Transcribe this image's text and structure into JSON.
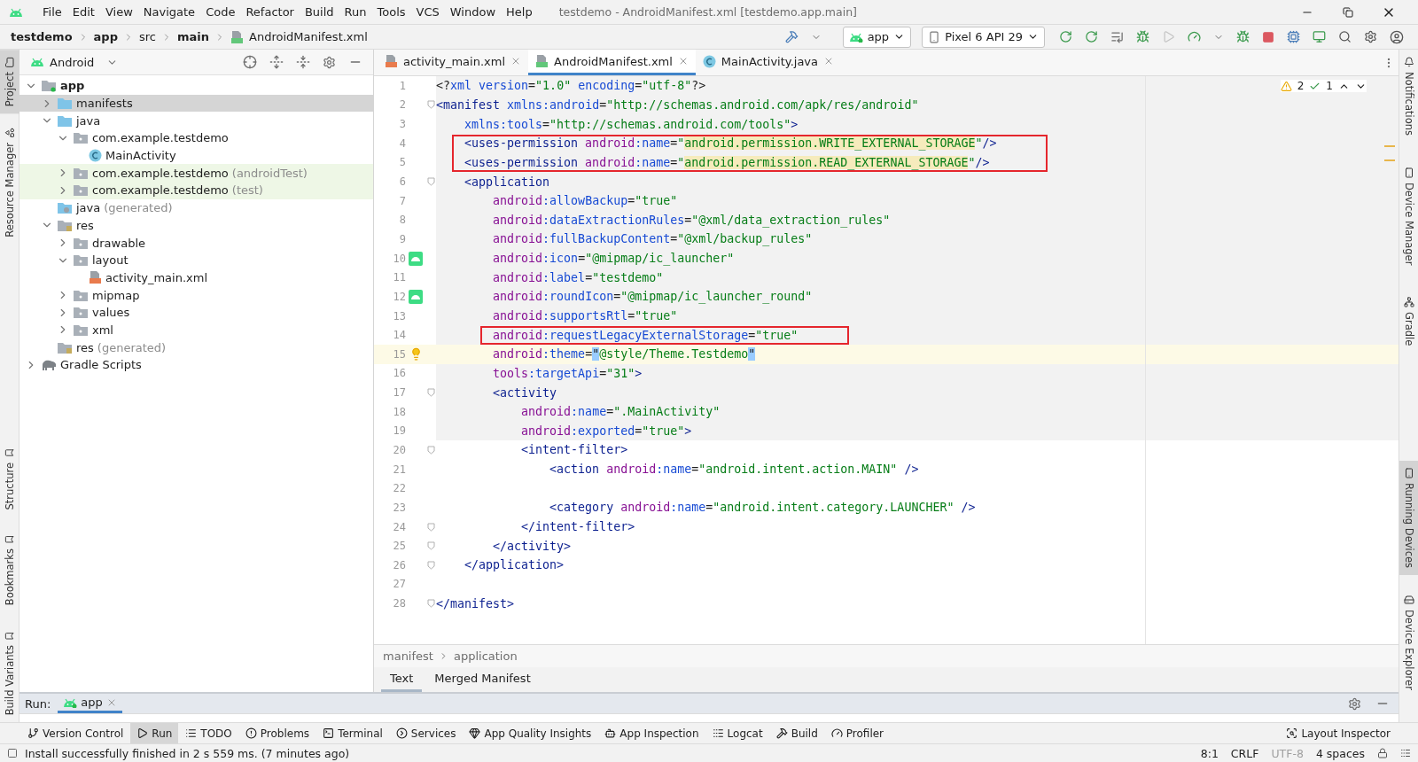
{
  "window": {
    "title": "testdemo - AndroidManifest.xml [testdemo.app.main]",
    "menu": [
      "File",
      "Edit",
      "View",
      "Navigate",
      "Code",
      "Refactor",
      "Build",
      "Run",
      "Tools",
      "VCS",
      "Window",
      "Help"
    ]
  },
  "navbar": {
    "breadcrumbs": [
      {
        "text": "testdemo",
        "bold": true
      },
      {
        "text": "app",
        "bold": true
      },
      {
        "text": "src",
        "bold": false
      },
      {
        "text": "main",
        "bold": true
      },
      {
        "text": "AndroidManifest.xml",
        "bold": false
      }
    ],
    "run_config": "app",
    "device": "Pixel 6 API 29"
  },
  "left_strip": {
    "top": [
      {
        "label": "Project",
        "selected": true
      },
      {
        "label": "Resource Manager",
        "selected": false
      }
    ],
    "bottom": [
      {
        "label": "Structure",
        "selected": false
      },
      {
        "label": "Bookmarks",
        "selected": false
      },
      {
        "label": "Build Variants",
        "selected": false
      }
    ]
  },
  "right_strip": {
    "top": [
      {
        "label": "Notifications",
        "selected": false
      },
      {
        "label": "Device Manager",
        "selected": false
      },
      {
        "label": "Gradle",
        "selected": false
      }
    ],
    "bottom": [
      {
        "label": "Running Devices",
        "selected": true
      },
      {
        "label": "Device Explorer",
        "selected": false
      }
    ]
  },
  "project": {
    "view": "Android",
    "tree": [
      {
        "label": "app",
        "kind": "module",
        "expandable": true,
        "expanded": true,
        "selected": false,
        "tinted": false,
        "children": [
          {
            "label": "manifests",
            "kind": "folder",
            "expandable": true,
            "expanded": false,
            "selected": true,
            "tinted": false
          },
          {
            "label": "java",
            "kind": "folder",
            "expandable": true,
            "expanded": true,
            "selected": false,
            "tinted": false,
            "children": [
              {
                "label": "com.example.testdemo",
                "kind": "package",
                "expandable": true,
                "expanded": true,
                "selected": false,
                "tinted": false,
                "children": [
                  {
                    "label": "MainActivity",
                    "kind": "class",
                    "expandable": false,
                    "selected": false,
                    "tinted": false
                  }
                ]
              },
              {
                "label": "com.example.testdemo",
                "note": "(androidTest)",
                "kind": "package",
                "expandable": true,
                "expanded": false,
                "selected": false,
                "tinted": true
              },
              {
                "label": "com.example.testdemo",
                "note": "(test)",
                "kind": "package",
                "expandable": true,
                "expanded": false,
                "selected": false,
                "tinted": true
              }
            ]
          },
          {
            "label": "java",
            "note": "(generated)",
            "kind": "generated",
            "expandable": false,
            "selected": false,
            "tinted": false
          },
          {
            "label": "res",
            "kind": "res",
            "expandable": true,
            "expanded": true,
            "selected": false,
            "tinted": false,
            "children": [
              {
                "label": "drawable",
                "kind": "package",
                "expandable": true,
                "expanded": false,
                "selected": false,
                "tinted": false
              },
              {
                "label": "layout",
                "kind": "package",
                "expandable": true,
                "expanded": true,
                "selected": false,
                "tinted": false,
                "children": [
                  {
                    "label": "activity_main.xml",
                    "kind": "layout",
                    "expandable": false,
                    "selected": false,
                    "tinted": false
                  }
                ]
              },
              {
                "label": "mipmap",
                "kind": "package",
                "expandable": true,
                "expanded": false,
                "selected": false,
                "tinted": false
              },
              {
                "label": "values",
                "kind": "package",
                "expandable": true,
                "expanded": false,
                "selected": false,
                "tinted": false
              },
              {
                "label": "xml",
                "kind": "package",
                "expandable": true,
                "expanded": false,
                "selected": false,
                "tinted": false
              }
            ]
          },
          {
            "label": "res",
            "note": "(generated)",
            "kind": "res",
            "expandable": false,
            "selected": false,
            "tinted": false
          }
        ]
      },
      {
        "label": "Gradle Scripts",
        "kind": "gradle",
        "expandable": true,
        "expanded": false,
        "selected": false,
        "tinted": false
      }
    ]
  },
  "editor": {
    "tabs": [
      {
        "label": "activity_main.xml",
        "kind": "layout",
        "selected": false
      },
      {
        "label": "AndroidManifest.xml",
        "kind": "manifest",
        "selected": true
      },
      {
        "label": "MainActivity.java",
        "kind": "class",
        "selected": false
      }
    ],
    "inspections": {
      "warnings": "2",
      "passed": "1"
    },
    "lines": [
      {
        "number": "1",
        "kind": "plain",
        "shaded": true,
        "caret": false,
        "fold": false,
        "boxed": false,
        "tokens": [
          {
            "kind": "p",
            "text": "<?"
          },
          {
            "kind": "a",
            "text": "xml"
          },
          {
            "kind": "a",
            "text": " version"
          },
          {
            "kind": "p",
            "text": "="
          },
          {
            "kind": "v",
            "text": "\"1.0\""
          },
          {
            "kind": "a",
            "text": " encoding"
          },
          {
            "kind": "p",
            "text": "="
          },
          {
            "kind": "v",
            "text": "\"utf-8\""
          },
          {
            "kind": "p",
            "text": "?>"
          }
        ]
      },
      {
        "number": "2",
        "kind": "plain",
        "shaded": true,
        "caret": false,
        "fold": true,
        "boxed": false,
        "tokens": [
          {
            "kind": "t",
            "text": "<manifest"
          },
          {
            "kind": "a",
            "text": " xmlns:android"
          },
          {
            "kind": "p",
            "text": "="
          },
          {
            "kind": "v",
            "text": "\"http://schemas.android.com/apk/res/android\""
          }
        ]
      },
      {
        "number": "3",
        "kind": "plain",
        "shaded": true,
        "caret": false,
        "fold": false,
        "boxed": false,
        "tokens": [
          {
            "kind": "a",
            "text": "    xmlns:tools"
          },
          {
            "kind": "p",
            "text": "="
          },
          {
            "kind": "v",
            "text": "\"http://schemas.android.com/tools\""
          },
          {
            "kind": "t",
            "text": ">"
          }
        ]
      },
      {
        "number": "4",
        "kind": "plain",
        "shaded": true,
        "caret": false,
        "fold": false,
        "boxed": true,
        "tokens": [
          {
            "kind": "t",
            "text": "    <uses-permission"
          },
          {
            "kind": "n",
            "text": " android"
          },
          {
            "kind": "a",
            "text": ":name"
          },
          {
            "kind": "p",
            "text": "="
          },
          {
            "kind": "v",
            "text": "\""
          },
          {
            "kind": "h",
            "text": "android.permission.WRITE_EXTERNAL_STORAGE"
          },
          {
            "kind": "v",
            "text": "\""
          },
          {
            "kind": "t",
            "text": "/>"
          }
        ]
      },
      {
        "number": "5",
        "kind": "plain",
        "shaded": true,
        "caret": false,
        "fold": false,
        "boxed": true,
        "tokens": [
          {
            "kind": "t",
            "text": "    <uses-permission"
          },
          {
            "kind": "n",
            "text": " android"
          },
          {
            "kind": "a",
            "text": ":name"
          },
          {
            "kind": "p",
            "text": "="
          },
          {
            "kind": "v",
            "text": "\""
          },
          {
            "kind": "h",
            "text": "android.permission.READ_EXTERNAL_STORAGE"
          },
          {
            "kind": "v",
            "text": "\""
          },
          {
            "kind": "t",
            "text": "/>"
          }
        ]
      },
      {
        "number": "6",
        "kind": "plain",
        "shaded": true,
        "caret": false,
        "fold": true,
        "boxed": false,
        "tokens": [
          {
            "kind": "t",
            "text": "    <application"
          }
        ]
      },
      {
        "number": "7",
        "kind": "plain",
        "shaded": true,
        "caret": false,
        "fold": false,
        "boxed": false,
        "tokens": [
          {
            "kind": "n",
            "text": "        android"
          },
          {
            "kind": "a",
            "text": ":allowBackup"
          },
          {
            "kind": "p",
            "text": "="
          },
          {
            "kind": "v",
            "text": "\"true\""
          }
        ]
      },
      {
        "number": "8",
        "kind": "plain",
        "shaded": true,
        "caret": false,
        "fold": false,
        "boxed": false,
        "tokens": [
          {
            "kind": "n",
            "text": "        android"
          },
          {
            "kind": "a",
            "text": ":dataExtractionRules"
          },
          {
            "kind": "p",
            "text": "="
          },
          {
            "kind": "v",
            "text": "\"@xml/data_extraction_rules\""
          }
        ]
      },
      {
        "number": "9",
        "kind": "plain",
        "shaded": true,
        "caret": false,
        "fold": false,
        "boxed": false,
        "tokens": [
          {
            "kind": "n",
            "text": "        android"
          },
          {
            "kind": "a",
            "text": ":fullBackupContent"
          },
          {
            "kind": "p",
            "text": "="
          },
          {
            "kind": "v",
            "text": "\"@xml/backup_rules\""
          }
        ]
      },
      {
        "number": "10",
        "kind": "launcher",
        "shaded": true,
        "caret": false,
        "fold": false,
        "boxed": false,
        "tokens": [
          {
            "kind": "n",
            "text": "        android"
          },
          {
            "kind": "a",
            "text": ":icon"
          },
          {
            "kind": "p",
            "text": "="
          },
          {
            "kind": "v",
            "text": "\"@mipmap/ic_launcher\""
          }
        ]
      },
      {
        "number": "11",
        "kind": "plain",
        "shaded": true,
        "caret": false,
        "fold": false,
        "boxed": false,
        "tokens": [
          {
            "kind": "n",
            "text": "        android"
          },
          {
            "kind": "a",
            "text": ":label"
          },
          {
            "kind": "p",
            "text": "="
          },
          {
            "kind": "v",
            "text": "\"testdemo\""
          }
        ]
      },
      {
        "number": "12",
        "kind": "launcher",
        "shaded": true,
        "caret": false,
        "fold": false,
        "boxed": false,
        "tokens": [
          {
            "kind": "n",
            "text": "        android"
          },
          {
            "kind": "a",
            "text": ":roundIcon"
          },
          {
            "kind": "p",
            "text": "="
          },
          {
            "kind": "v",
            "text": "\"@mipmap/ic_launcher_round\""
          }
        ]
      },
      {
        "number": "13",
        "kind": "plain",
        "shaded": true,
        "caret": false,
        "fold": false,
        "boxed": false,
        "tokens": [
          {
            "kind": "n",
            "text": "        android"
          },
          {
            "kind": "a",
            "text": ":supportsRtl"
          },
          {
            "kind": "p",
            "text": "="
          },
          {
            "kind": "v",
            "text": "\"true\""
          }
        ]
      },
      {
        "number": "14",
        "kind": "plain",
        "shaded": true,
        "caret": false,
        "fold": false,
        "boxed": true,
        "tokens": [
          {
            "kind": "n",
            "text": "        android"
          },
          {
            "kind": "a",
            "text": ":requestLegacyExternalStorage"
          },
          {
            "kind": "p",
            "text": "="
          },
          {
            "kind": "v",
            "text": "\"true\""
          }
        ]
      },
      {
        "number": "15",
        "kind": "bulb",
        "shaded": false,
        "caret": true,
        "fold": false,
        "boxed": false,
        "tokens": [
          {
            "kind": "n",
            "text": "        android"
          },
          {
            "kind": "a",
            "text": ":theme"
          },
          {
            "kind": "p",
            "text": "="
          },
          {
            "kind": "q",
            "text": "\""
          },
          {
            "kind": "v",
            "text": "@style/Theme.Testdemo"
          },
          {
            "kind": "q",
            "text": "\""
          }
        ]
      },
      {
        "number": "16",
        "kind": "plain",
        "shaded": true,
        "caret": false,
        "fold": false,
        "boxed": false,
        "tokens": [
          {
            "kind": "n",
            "text": "        tools"
          },
          {
            "kind": "a",
            "text": ":targetApi"
          },
          {
            "kind": "p",
            "text": "="
          },
          {
            "kind": "v",
            "text": "\"31\""
          },
          {
            "kind": "t",
            "text": ">"
          }
        ]
      },
      {
        "number": "17",
        "kind": "plain",
        "shaded": true,
        "caret": false,
        "fold": true,
        "boxed": false,
        "tokens": [
          {
            "kind": "t",
            "text": "        <activity"
          }
        ]
      },
      {
        "number": "18",
        "kind": "plain",
        "shaded": true,
        "caret": false,
        "fold": false,
        "boxed": false,
        "tokens": [
          {
            "kind": "n",
            "text": "            android"
          },
          {
            "kind": "a",
            "text": ":name"
          },
          {
            "kind": "p",
            "text": "="
          },
          {
            "kind": "v",
            "text": "\".MainActivity\""
          }
        ]
      },
      {
        "number": "19",
        "kind": "plain",
        "shaded": true,
        "caret": false,
        "fold": false,
        "boxed": false,
        "tokens": [
          {
            "kind": "n",
            "text": "            android"
          },
          {
            "kind": "a",
            "text": ":exported"
          },
          {
            "kind": "p",
            "text": "="
          },
          {
            "kind": "v",
            "text": "\"true\""
          },
          {
            "kind": "t",
            "text": ">"
          }
        ]
      },
      {
        "number": "20",
        "kind": "plain",
        "shaded": false,
        "caret": false,
        "fold": true,
        "boxed": false,
        "tokens": [
          {
            "kind": "t",
            "text": "            <intent-filter>"
          }
        ]
      },
      {
        "number": "21",
        "kind": "plain",
        "shaded": false,
        "caret": false,
        "fold": false,
        "boxed": false,
        "tokens": [
          {
            "kind": "t",
            "text": "                <action"
          },
          {
            "kind": "n",
            "text": " android"
          },
          {
            "kind": "a",
            "text": ":name"
          },
          {
            "kind": "p",
            "text": "="
          },
          {
            "kind": "v",
            "text": "\"android.intent.action.MAIN\""
          },
          {
            "kind": "t",
            "text": " />"
          }
        ]
      },
      {
        "number": "22",
        "kind": "plain",
        "shaded": false,
        "caret": false,
        "fold": false,
        "boxed": false
      },
      {
        "number": "23",
        "kind": "plain",
        "shaded": false,
        "caret": false,
        "fold": false,
        "boxed": false,
        "tokens": [
          {
            "kind": "t",
            "text": "                <category"
          },
          {
            "kind": "n",
            "text": " android"
          },
          {
            "kind": "a",
            "text": ":name"
          },
          {
            "kind": "p",
            "text": "="
          },
          {
            "kind": "v",
            "text": "\"android.intent.category.LAUNCHER\""
          },
          {
            "kind": "t",
            "text": " />"
          }
        ]
      },
      {
        "number": "24",
        "kind": "plain",
        "shaded": false,
        "caret": false,
        "fold": true,
        "boxed": false,
        "tokens": [
          {
            "kind": "t",
            "text": "            </intent-filter>"
          }
        ]
      },
      {
        "number": "25",
        "kind": "plain",
        "shaded": false,
        "caret": false,
        "fold": true,
        "boxed": false,
        "tokens": [
          {
            "kind": "t",
            "text": "        </activity>"
          }
        ]
      },
      {
        "number": "26",
        "kind": "plain",
        "shaded": false,
        "caret": false,
        "fold": true,
        "boxed": false,
        "tokens": [
          {
            "kind": "t",
            "text": "    </application>"
          }
        ]
      },
      {
        "number": "27",
        "kind": "plain",
        "shaded": false,
        "caret": false,
        "fold": false,
        "boxed": false
      },
      {
        "number": "28",
        "kind": "plain",
        "shaded": false,
        "caret": false,
        "fold": true,
        "boxed": false,
        "tokens": [
          {
            "kind": "t",
            "text": "</manifest>"
          }
        ]
      }
    ],
    "breadcrumbs": [
      "manifest",
      "application"
    ],
    "view_tabs": [
      {
        "label": "Text",
        "selected": true
      },
      {
        "label": "Merged Manifest",
        "selected": false
      }
    ]
  },
  "run_panel": {
    "title": "Run:",
    "tabs": [
      {
        "label": "app",
        "selected": true
      }
    ]
  },
  "tool_windows": {
    "left": [
      {
        "label": "Version Control",
        "kind": "vcs",
        "selected": false
      },
      {
        "label": "Run",
        "kind": "run",
        "selected": true
      },
      {
        "label": "TODO",
        "kind": "todo",
        "selected": false
      },
      {
        "label": "Problems",
        "kind": "problems",
        "selected": false
      },
      {
        "label": "Terminal",
        "kind": "terminal",
        "selected": false
      },
      {
        "label": "Services",
        "kind": "services",
        "selected": false
      },
      {
        "label": "App Quality Insights",
        "kind": "quality",
        "selected": false
      },
      {
        "label": "App Inspection",
        "kind": "inspection",
        "selected": false
      },
      {
        "label": "Logcat",
        "kind": "logcat",
        "selected": false
      },
      {
        "label": "Build",
        "kind": "build",
        "selected": false
      },
      {
        "label": "Profiler",
        "kind": "profiler",
        "selected": false
      }
    ],
    "right": [
      {
        "label": "Layout Inspector",
        "kind": "layout-inspector",
        "selected": false
      }
    ]
  },
  "status_bar": {
    "message": "Install successfully finished in 2 s 559 ms. (7 minutes ago)",
    "position": "8:1",
    "line_separator": "CRLF",
    "encoding": "UTF-8",
    "indent": "4 spaces"
  }
}
